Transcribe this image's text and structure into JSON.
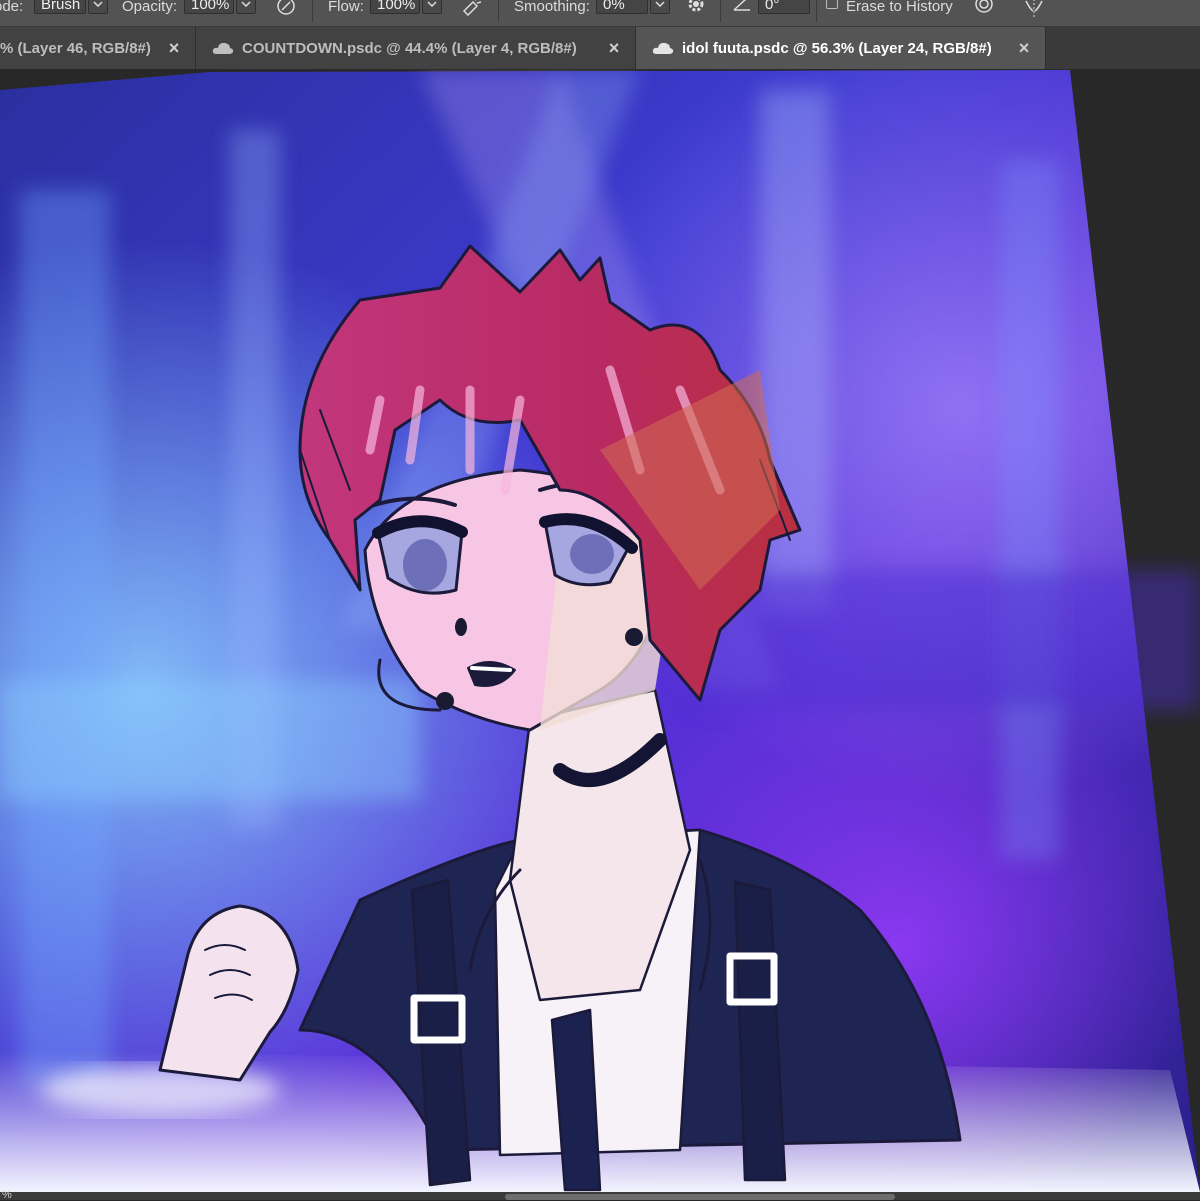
{
  "options_bar": {
    "mode_label": "ode:",
    "mode_value": "Brush",
    "opacity_label": "Opacity:",
    "opacity_value": "100%",
    "flow_label": "Flow:",
    "flow_value": "100%",
    "smoothing_label": "Smoothing:",
    "smoothing_value": "0%",
    "angle_value": "0°",
    "erase_to_history_label": "Erase to History",
    "icons": [
      "pressure-opacity-icon",
      "airbrush-icon",
      "gear-icon",
      "angle-icon",
      "pressure-size-icon",
      "symmetry-icon"
    ]
  },
  "tabs": [
    {
      "label": "% (Layer 46, RGB/8#)",
      "active": false
    },
    {
      "label": "COUNTDOWN.psdc @ 44.4% (Layer 4, RGB/8#)",
      "active": false,
      "cloud": true
    },
    {
      "label": "idol fuuta.psdc @ 56.3% (Layer 24, RGB/8#)",
      "active": true,
      "cloud": true
    }
  ],
  "canvas": {
    "document": "idol fuuta.psdc",
    "zoom": "56.3%",
    "layer": "Layer 24",
    "mode": "RGB/8#"
  },
  "status_bar": {
    "text": "%"
  },
  "colors": {
    "panel": "#535353",
    "tab_active": "#555555",
    "workspace": "#282828",
    "hair": "#b8306a",
    "jacket": "#22264f"
  }
}
